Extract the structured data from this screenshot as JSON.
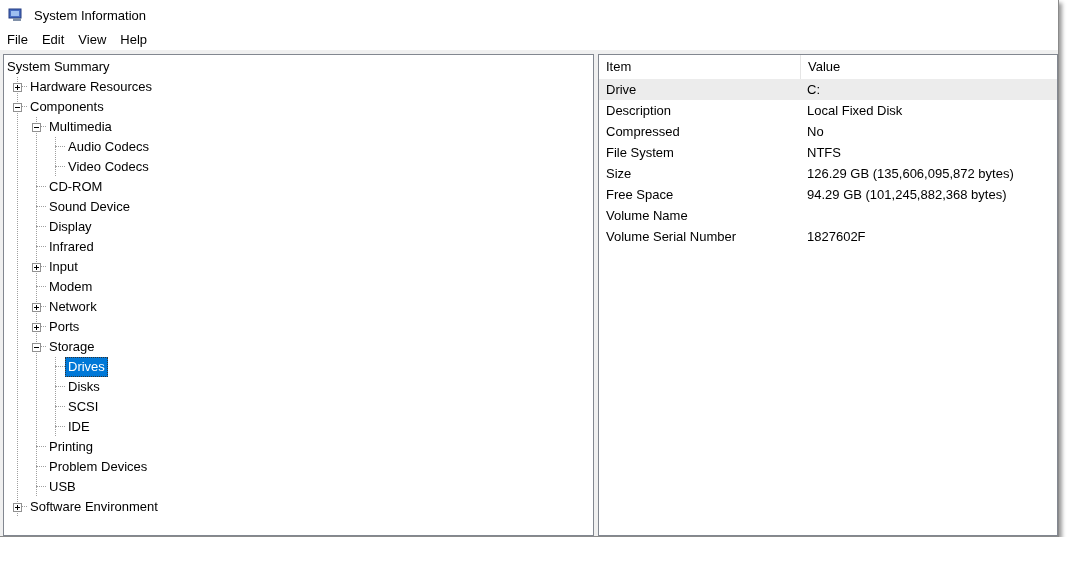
{
  "window": {
    "title": "System Information"
  },
  "menu": [
    "File",
    "Edit",
    "View",
    "Help"
  ],
  "tree": [
    {
      "label": "System Summary",
      "selected": false,
      "children": [
        {
          "label": "Hardware Resources",
          "selected": false,
          "expanded": false
        },
        {
          "label": "Components",
          "selected": false,
          "expanded": true,
          "children": [
            {
              "label": "Multimedia",
              "selected": false,
              "expanded": true,
              "children": [
                {
                  "label": "Audio Codecs",
                  "selected": false
                },
                {
                  "label": "Video Codecs",
                  "selected": false
                }
              ]
            },
            {
              "label": "CD-ROM",
              "selected": false
            },
            {
              "label": "Sound Device",
              "selected": false
            },
            {
              "label": "Display",
              "selected": false
            },
            {
              "label": "Infrared",
              "selected": false
            },
            {
              "label": "Input",
              "selected": false,
              "expanded": false
            },
            {
              "label": "Modem",
              "selected": false
            },
            {
              "label": "Network",
              "selected": false,
              "expanded": false
            },
            {
              "label": "Ports",
              "selected": false,
              "expanded": false
            },
            {
              "label": "Storage",
              "selected": false,
              "expanded": true,
              "children": [
                {
                  "label": "Drives",
                  "selected": true
                },
                {
                  "label": "Disks",
                  "selected": false
                },
                {
                  "label": "SCSI",
                  "selected": false
                },
                {
                  "label": "IDE",
                  "selected": false
                }
              ]
            },
            {
              "label": "Printing",
              "selected": false
            },
            {
              "label": "Problem Devices",
              "selected": false
            },
            {
              "label": "USB",
              "selected": false
            }
          ]
        },
        {
          "label": "Software Environment",
          "selected": false,
          "expanded": false
        }
      ]
    }
  ],
  "table": {
    "columns": [
      "Item",
      "Value"
    ],
    "rows": [
      {
        "item": "Drive",
        "value": "C:",
        "selected": true
      },
      {
        "item": "Description",
        "value": "Local Fixed Disk",
        "selected": false
      },
      {
        "item": "Compressed",
        "value": "No",
        "selected": false
      },
      {
        "item": "File System",
        "value": "NTFS",
        "selected": false
      },
      {
        "item": "Size",
        "value": "126.29 GB (135,606,095,872 bytes)",
        "selected": false
      },
      {
        "item": "Free Space",
        "value": "94.29 GB (101,245,882,368 bytes)",
        "selected": false
      },
      {
        "item": "Volume Name",
        "selected": false
      },
      {
        "item": "Volume Serial Number",
        "value": "1827602F",
        "selected": false
      }
    ]
  }
}
